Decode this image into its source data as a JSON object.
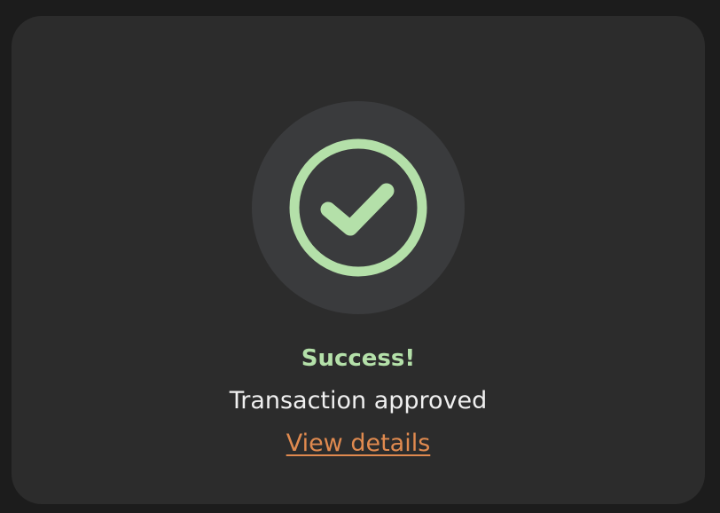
{
  "card": {
    "title": "Success!",
    "message": "Transaction approved",
    "link_label": "View details"
  },
  "icons": {
    "status": "check-circle-icon"
  },
  "colors": {
    "background": "#1c1c1c",
    "card": "#2c2c2c",
    "icon_backdrop": "#3a3b3d",
    "success": "#b4e0a9",
    "text": "#f0f0f0",
    "link": "#e08a4f"
  }
}
